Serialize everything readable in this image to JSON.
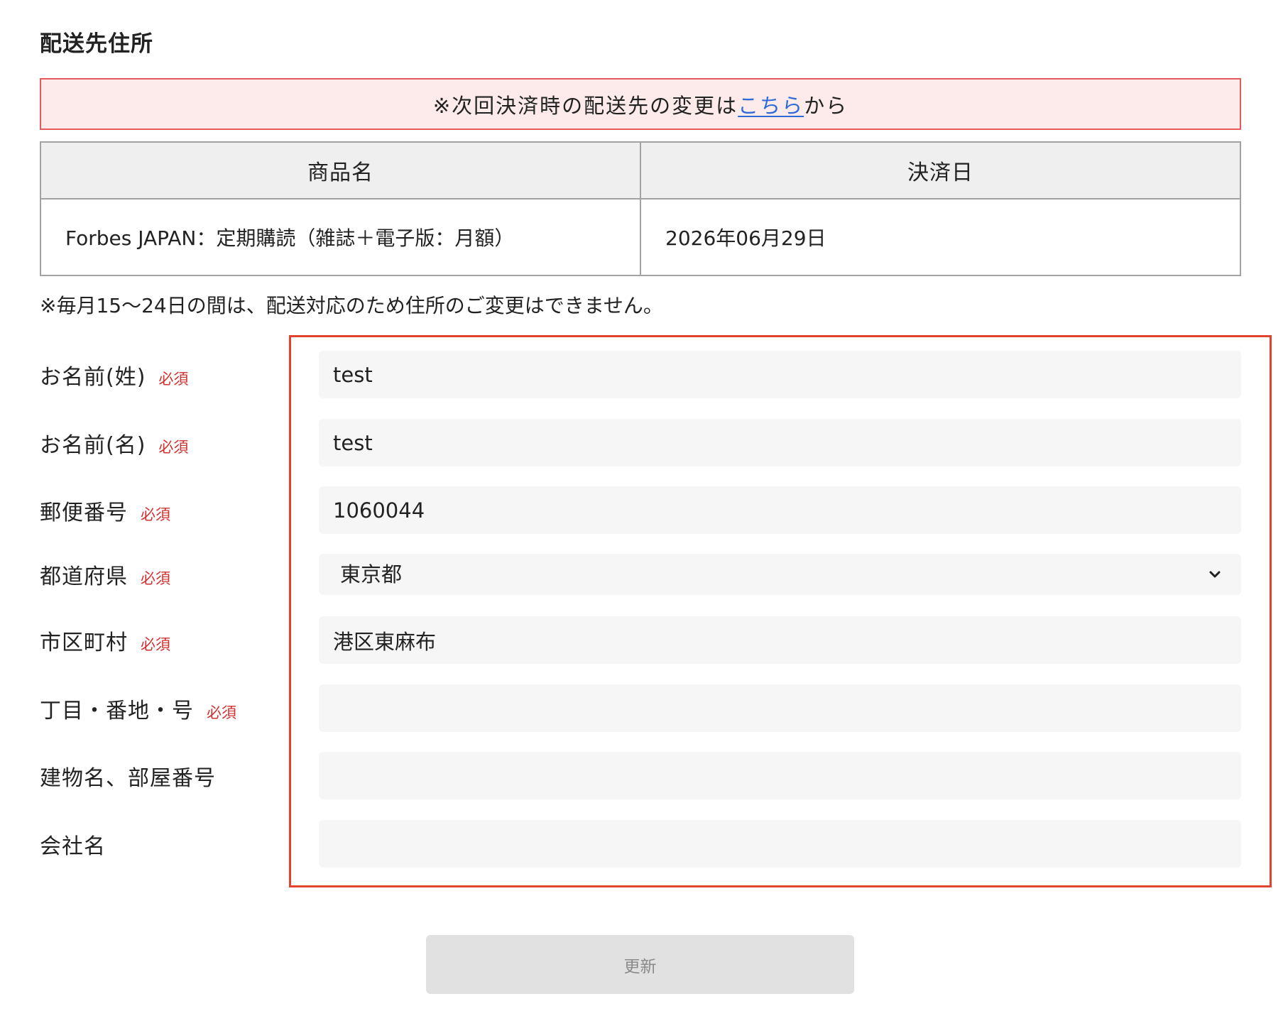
{
  "section_title": "配送先住所",
  "notice": {
    "prefix": "※次回決済時の配送先の変更は",
    "link": "こちら",
    "suffix": "から"
  },
  "table": {
    "headers": [
      "商品名",
      "決済日"
    ],
    "rows": [
      [
        "Forbes JAPAN：定期購読（雑誌＋電子版：月額）",
        "2026年06月29日"
      ]
    ]
  },
  "note": "※毎月15〜24日の間は、配送対応のため住所のご変更はできません。",
  "form": {
    "required_label": "必須",
    "fields": [
      {
        "label": "お名前(姓)",
        "required": true,
        "value": "test"
      },
      {
        "label": "お名前(名)",
        "required": true,
        "value": "test"
      },
      {
        "label": "郵便番号",
        "required": true,
        "value": "1060044"
      },
      {
        "label": "都道府県",
        "required": true,
        "value": "東京都"
      },
      {
        "label": "市区町村",
        "required": true,
        "value": "港区東麻布"
      },
      {
        "label": "丁目・番地・号",
        "required": true,
        "value": ""
      },
      {
        "label": "建物名、部屋番号",
        "required": false,
        "value": ""
      },
      {
        "label": "会社名",
        "required": false,
        "value": ""
      }
    ]
  },
  "submit_label": "更新",
  "icons": {
    "select_arrow": "chevron-down-icon"
  },
  "colors": {
    "notice_bg": "#fdeaea",
    "notice_border": "#e35b5b",
    "link": "#2e6bd6",
    "required": "#d0302f",
    "highlight_border": "#e2432d",
    "input_bg": "#f6f6f6",
    "table_header_bg": "#efefef",
    "table_border": "#a2a2a2",
    "button_bg": "#e1e1e1",
    "button_text": "#8a8a8a"
  }
}
